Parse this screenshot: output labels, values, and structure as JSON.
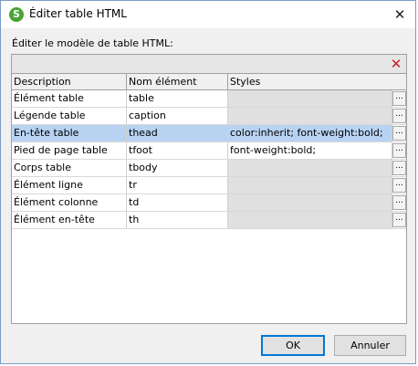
{
  "window": {
    "title": "Éditer table HTML",
    "app_icon_glyph": "S",
    "close_glyph": "✕"
  },
  "instruction": "Éditer le modèle de table HTML:",
  "toolbar": {
    "delete_glyph": "✕"
  },
  "table": {
    "columns": [
      "Description",
      "Nom élément",
      "Styles"
    ],
    "rows": [
      {
        "description": "Élément table",
        "element": "table",
        "styles": "",
        "selected": false
      },
      {
        "description": "Légende table",
        "element": "caption",
        "styles": "",
        "selected": false
      },
      {
        "description": "En-tête table",
        "element": "thead",
        "styles": "color:inherit; font-weight:bold;",
        "selected": true
      },
      {
        "description": "Pied de page table",
        "element": "tfoot",
        "styles": "font-weight:bold;",
        "selected": false
      },
      {
        "description": "Corps table",
        "element": "tbody",
        "styles": "",
        "selected": false
      },
      {
        "description": "Élément ligne",
        "element": "tr",
        "styles": "",
        "selected": false
      },
      {
        "description": "Élément colonne",
        "element": "td",
        "styles": "",
        "selected": false
      },
      {
        "description": "Élément en-tête",
        "element": "th",
        "styles": "",
        "selected": false
      }
    ],
    "edit_button_label": "..."
  },
  "buttons": {
    "ok": "OK",
    "cancel": "Annuler"
  },
  "colors": {
    "selection": "#b8d3f2",
    "delete_icon": "#c81e1e",
    "app_icon": "#4aa335"
  }
}
